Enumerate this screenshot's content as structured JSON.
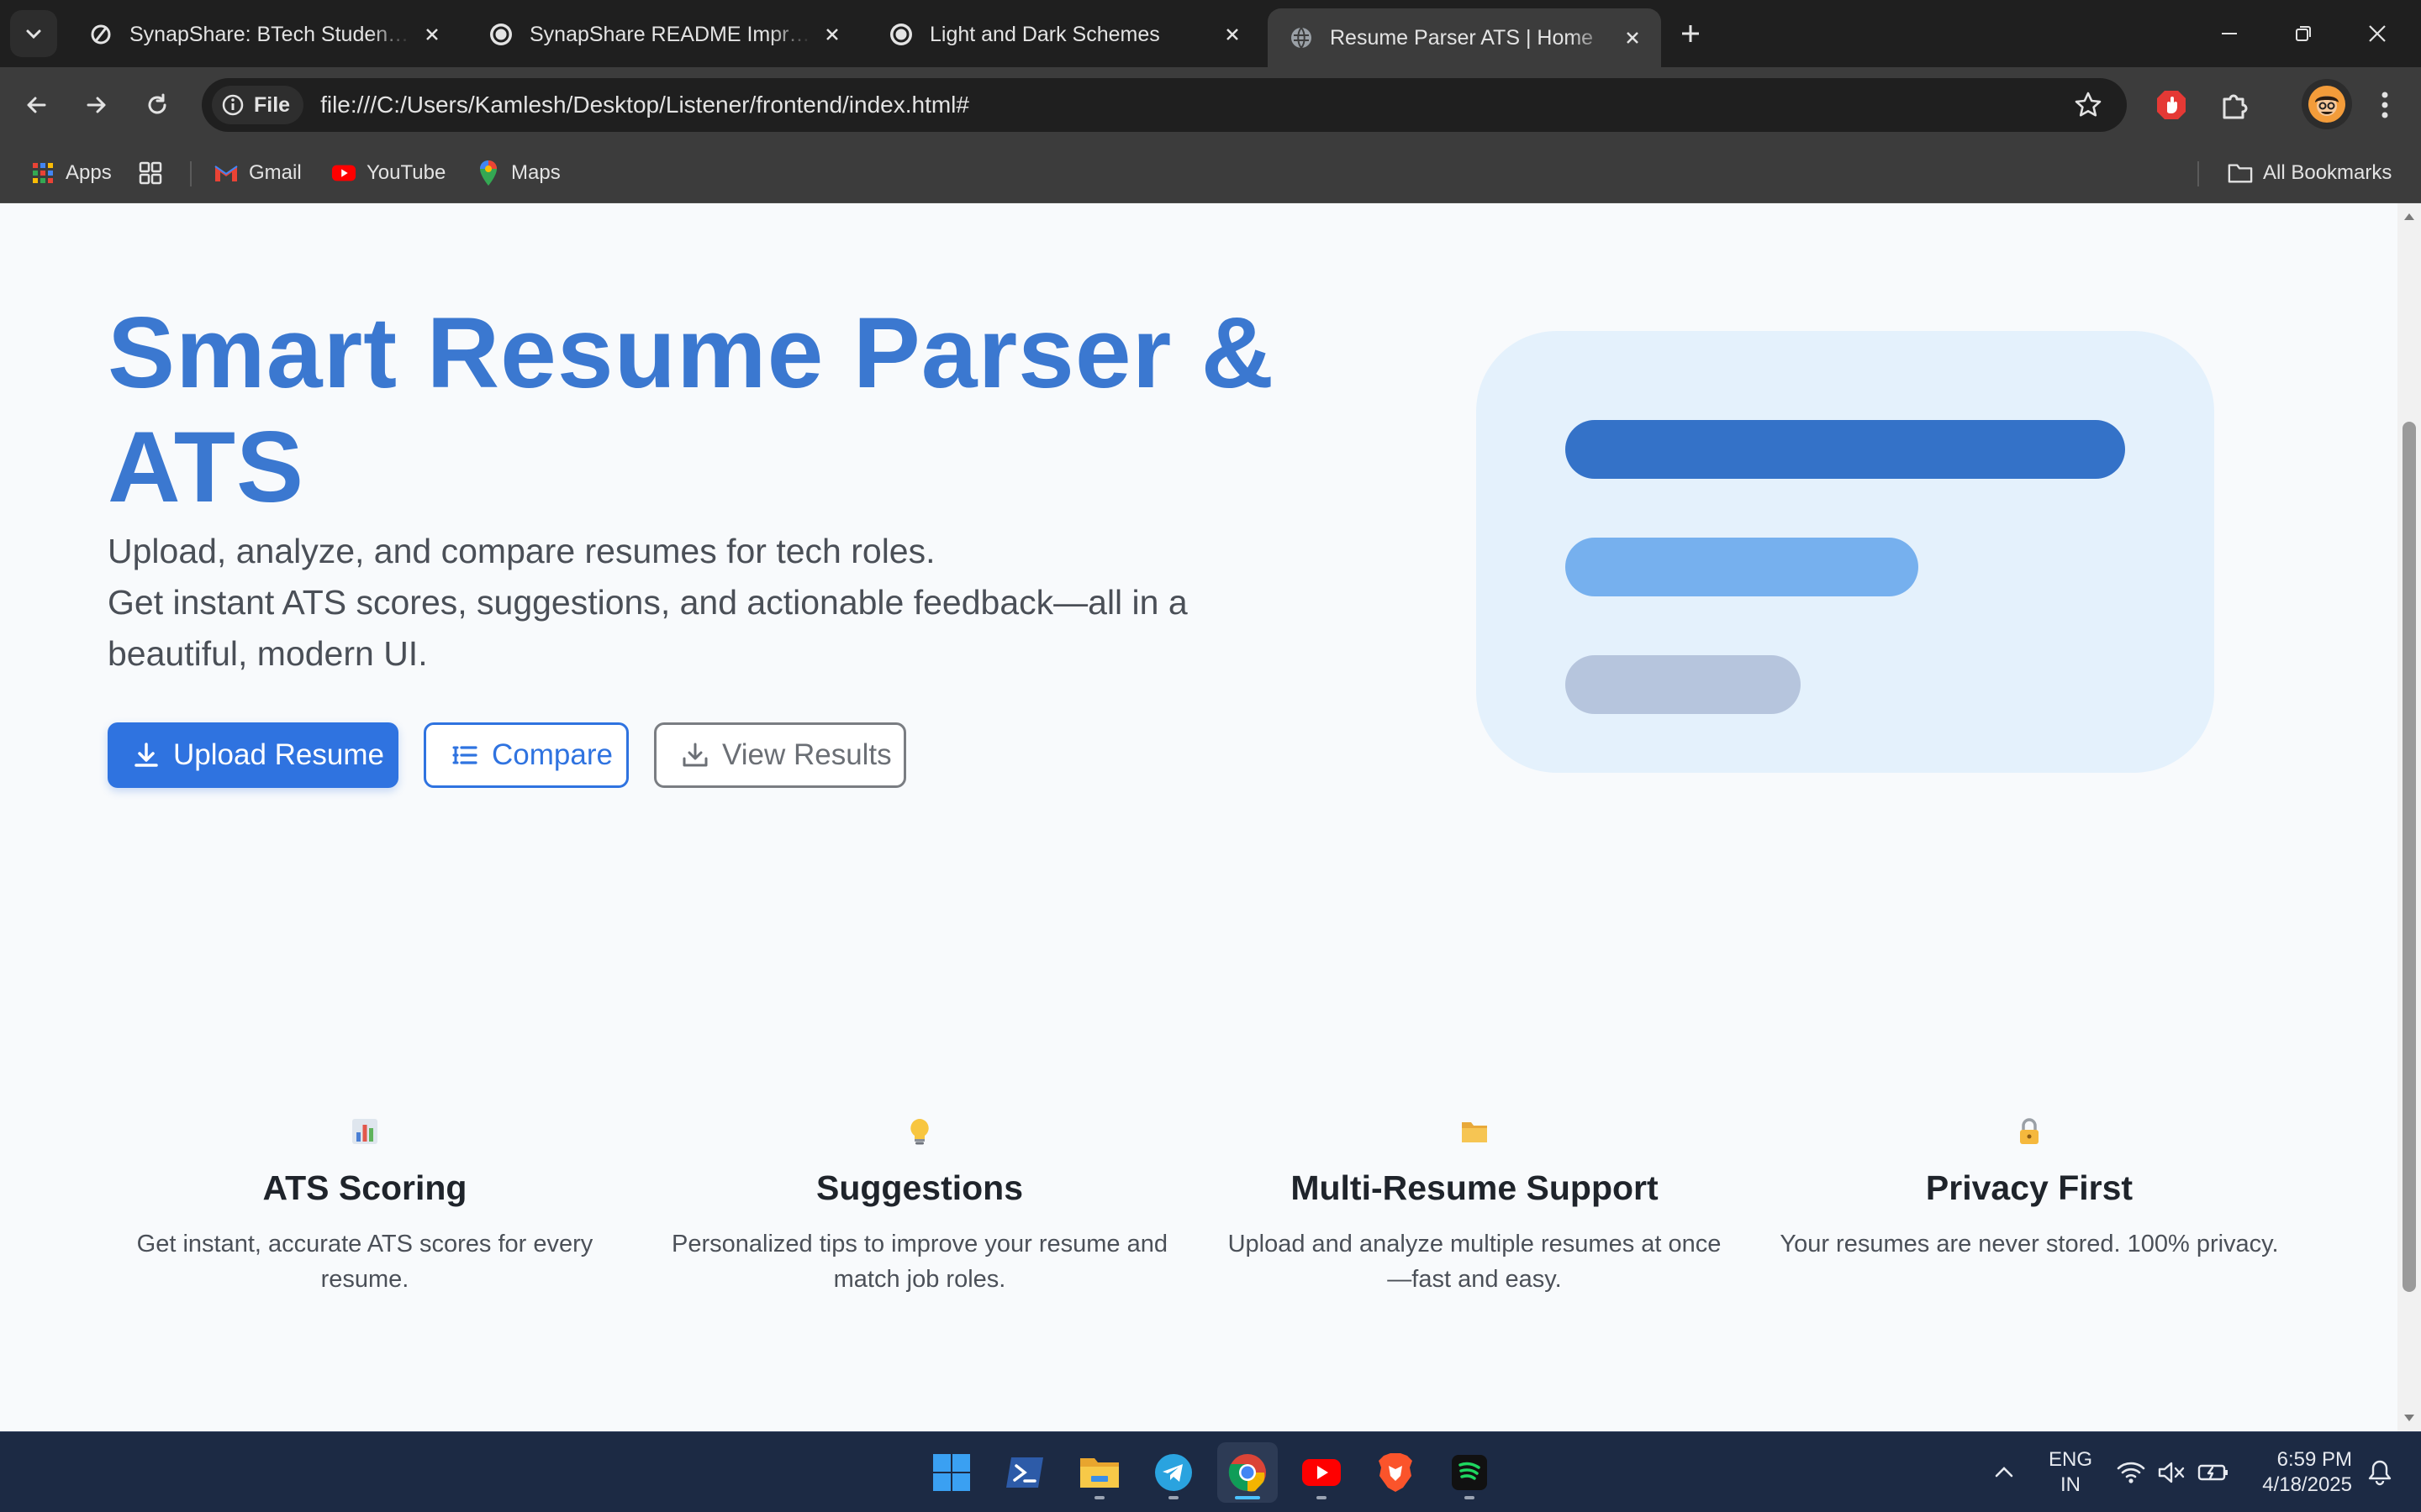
{
  "browser": {
    "tabs": [
      {
        "title": "SynapShare: BTech Student Platform",
        "active": false
      },
      {
        "title": "SynapShare README Improvements",
        "active": false
      },
      {
        "title": "Light and Dark Schemes",
        "active": false
      },
      {
        "title": "Resume Parser ATS | Home",
        "active": true
      }
    ],
    "address": {
      "chip": "File",
      "url": "file:///C:/Users/Kamlesh/Desktop/Listener/frontend/index.html#"
    },
    "bookmarks": [
      "Apps",
      "Gmail",
      "YouTube",
      "Maps"
    ],
    "all_bookmarks": "All Bookmarks"
  },
  "page": {
    "hero": {
      "title": "Smart Resume Parser & ATS",
      "subtitle_line1": "Upload, analyze, and compare resumes for tech roles.",
      "subtitle_line2": "Get instant ATS scores, suggestions, and actionable feedback—all in a beautiful, modern UI."
    },
    "buttons": {
      "upload": "Upload Resume",
      "compare": "Compare",
      "view": "View Results"
    },
    "features": [
      {
        "icon": "bar-chart-icon",
        "title": "ATS Scoring",
        "desc": "Get instant, accurate ATS scores for every resume."
      },
      {
        "icon": "lightbulb-icon",
        "title": "Suggestions",
        "desc": "Personalized tips to improve your resume and match job roles."
      },
      {
        "icon": "folder-icon",
        "title": "Multi-Resume Support",
        "desc": "Upload and analyze multiple resumes at once—fast and easy."
      },
      {
        "icon": "lock-icon",
        "title": "Privacy First",
        "desc": "Your resumes are never stored. 100% privacy."
      }
    ],
    "colors": {
      "accent": "#2f73e0",
      "title": "#3b78d0",
      "background": "#f8fafc"
    }
  },
  "taskbar": {
    "apps": [
      "start-icon",
      "terminal-icon",
      "file-explorer-icon",
      "telegram-icon",
      "chrome-icon",
      "youtube-icon",
      "brave-icon",
      "spotify-icon"
    ],
    "language": {
      "line1": "ENG",
      "line2": "IN"
    },
    "time": "6:59 PM",
    "date": "4/18/2025"
  }
}
